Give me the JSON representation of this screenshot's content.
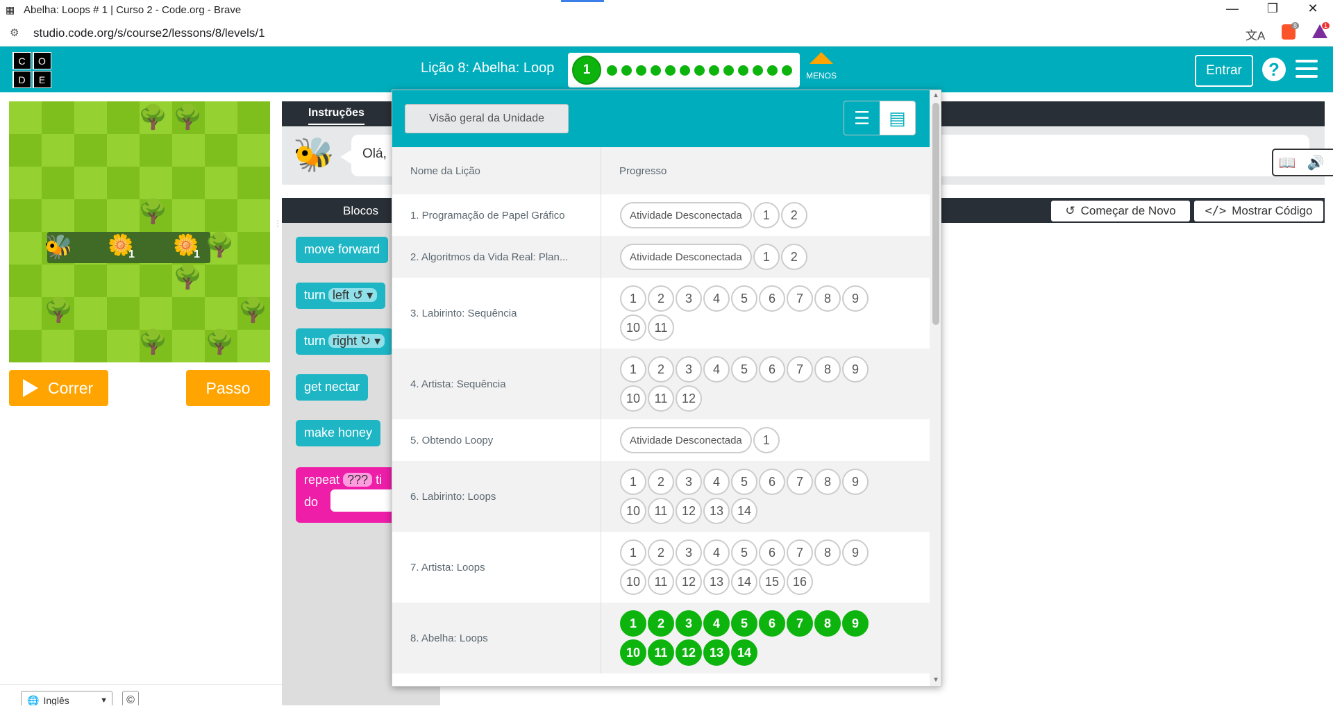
{
  "browser": {
    "window_title": "Abelha: Loops # 1 | Curso 2 - Code.org - Brave",
    "url": "studio.code.org/s/course2/lessons/8/levels/1",
    "minimize": "—",
    "restore": "❐",
    "close": "✕",
    "translate_icon": "文A",
    "brave_badge": "8",
    "alert_badge": "1"
  },
  "header": {
    "logo": [
      "C",
      "O",
      "D",
      "E"
    ],
    "lesson_title": "Lição 8: Abelha: Loop",
    "current_level": "1",
    "less_label": "MENOS",
    "signin_label": "Entrar",
    "help_label": "?"
  },
  "game": {
    "flower_counts": [
      "1",
      "1"
    ],
    "run_label": "Correr",
    "step_label": "Passo"
  },
  "footer": {
    "language": "Inglês",
    "copyright": "©"
  },
  "instructions": {
    "tab_label": "Instruções",
    "text": "Olá,"
  },
  "toolbox": {
    "title": "Blocos",
    "restart_label": "Começar de Novo",
    "show_code_label": "Mostrar Código",
    "blocks": {
      "move_forward": "move forward",
      "turn": "turn",
      "left": "left ↺ ▾",
      "right": "right ↻ ▾",
      "get_nectar": "get nectar",
      "make_honey": "make honey",
      "repeat": "repeat",
      "repeat_q": "???",
      "repeat_times": "ti",
      "do": "do"
    }
  },
  "overview": {
    "unit_overview_label": "Visão geral da Unidade",
    "col_lesson": "Nome da Lição",
    "col_progress": "Progresso",
    "lessons": [
      {
        "name": "1. Programação de Papel Gráfico",
        "pill": "Atividade Desconectada",
        "levels": [
          "1",
          "2"
        ],
        "done": false
      },
      {
        "name": "2. Algoritmos da Vida Real: Plan...",
        "pill": "Atividade Desconectada",
        "levels": [
          "1",
          "2"
        ],
        "done": false
      },
      {
        "name": "3. Labirinto: Sequência",
        "pill": "",
        "levels": [
          "1",
          "2",
          "3",
          "4",
          "5",
          "6",
          "7",
          "8",
          "9",
          "10",
          "11"
        ],
        "done": false
      },
      {
        "name": "4. Artista: Sequência",
        "pill": "",
        "levels": [
          "1",
          "2",
          "3",
          "4",
          "5",
          "6",
          "7",
          "8",
          "9",
          "10",
          "11",
          "12"
        ],
        "done": false
      },
      {
        "name": "5. Obtendo Loopy",
        "pill": "Atividade Desconectada",
        "levels": [
          "1"
        ],
        "done": false
      },
      {
        "name": "6. Labirinto: Loops",
        "pill": "",
        "levels": [
          "1",
          "2",
          "3",
          "4",
          "5",
          "6",
          "7",
          "8",
          "9",
          "10",
          "11",
          "12",
          "13",
          "14"
        ],
        "done": false
      },
      {
        "name": "7. Artista: Loops",
        "pill": "",
        "levels": [
          "1",
          "2",
          "3",
          "4",
          "5",
          "6",
          "7",
          "8",
          "9",
          "10",
          "11",
          "12",
          "13",
          "14",
          "15",
          "16"
        ],
        "done": false
      },
      {
        "name": "8. Abelha: Loops",
        "pill": "",
        "levels": [
          "1",
          "2",
          "3",
          "4",
          "5",
          "6",
          "7",
          "8",
          "9",
          "10",
          "11",
          "12",
          "13",
          "14"
        ],
        "done": true
      }
    ]
  },
  "colors": {
    "brand_teal": "#00adbc",
    "orange": "#ffa400",
    "green_done": "#0eb40e",
    "block_cyan": "#1eb6c5",
    "block_pink": "#ee1ea9"
  }
}
